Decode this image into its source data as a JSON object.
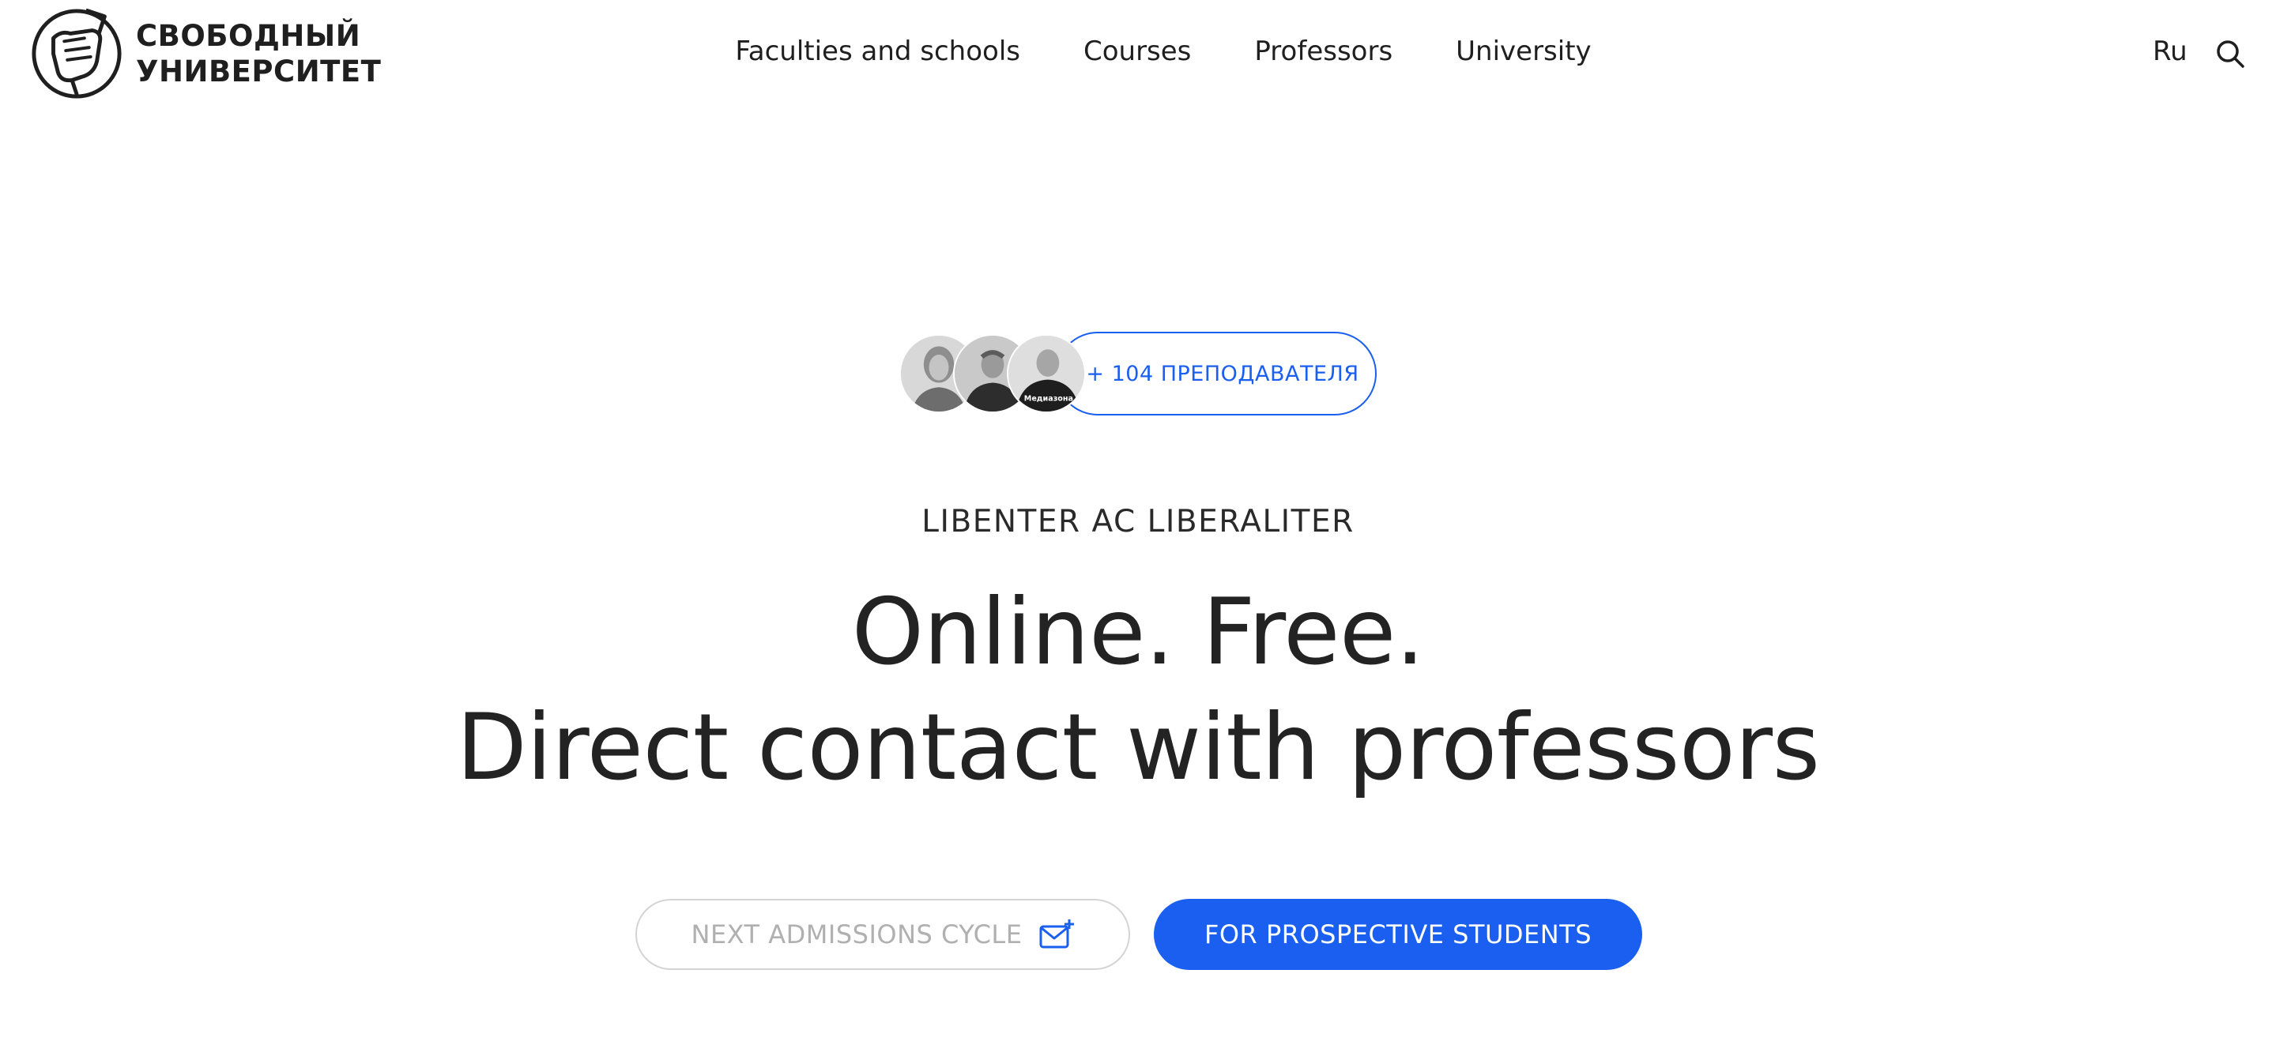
{
  "header": {
    "logo": {
      "line1": "СВОБОДНЫЙ",
      "line2": "УНИВЕРСИТЕТ",
      "icon": "raised-fist-pencil-icon"
    },
    "nav": [
      {
        "label": "Faculties and schools"
      },
      {
        "label": "Courses"
      },
      {
        "label": "Professors"
      },
      {
        "label": "University"
      }
    ],
    "lang_label": "Ru",
    "search_icon": "search-icon"
  },
  "hero": {
    "teachers_badge": "+ 104 ПРЕПОДАВАТЕЛЯ",
    "avatar3_caption": "Медиазона",
    "eyebrow": "LIBENTER AC LIBERALITER",
    "headline_line1": "Online. Free.",
    "headline_line2": "Direct contact with professors",
    "secondary_button": "NEXT ADMISSIONS CYCLE",
    "secondary_button_icon": "mail-plus-icon",
    "primary_button": "FOR PROSPECTIVE STUDENTS"
  },
  "colors": {
    "accent": "#1a5ff0",
    "text": "#232323",
    "muted": "#b0b0b0"
  }
}
